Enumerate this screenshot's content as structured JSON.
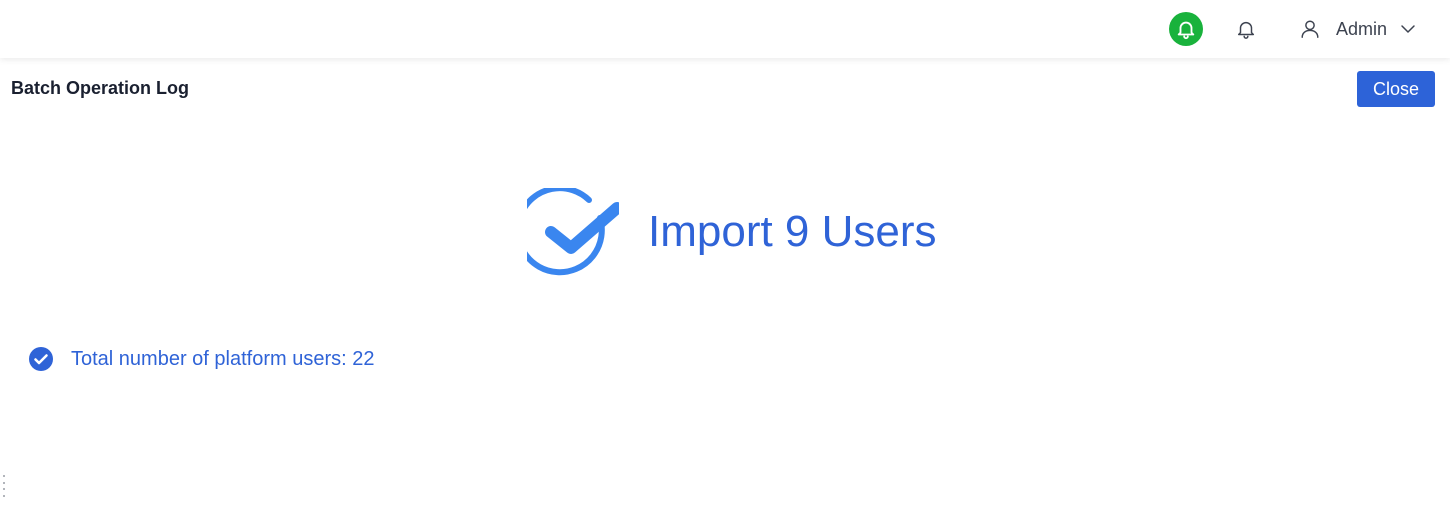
{
  "header": {
    "notification_green_icon": "bell-icon",
    "notification_icon": "bell-icon",
    "user": {
      "icon": "user-icon",
      "name": "Admin",
      "dropdown_icon": "chevron-down-icon"
    }
  },
  "page": {
    "title": "Batch Operation Log",
    "close_label": "Close"
  },
  "result": {
    "icon": "check-circle-icon",
    "title": "Import 9 Users"
  },
  "stats": [
    {
      "icon": "check-circle-filled-icon",
      "text": "Total number of platform users: 22"
    }
  ],
  "colors": {
    "accent": "#2f63d7",
    "button": "#2d63d8",
    "success_green": "#19b23c",
    "icon_blue": "#3a86ef"
  }
}
